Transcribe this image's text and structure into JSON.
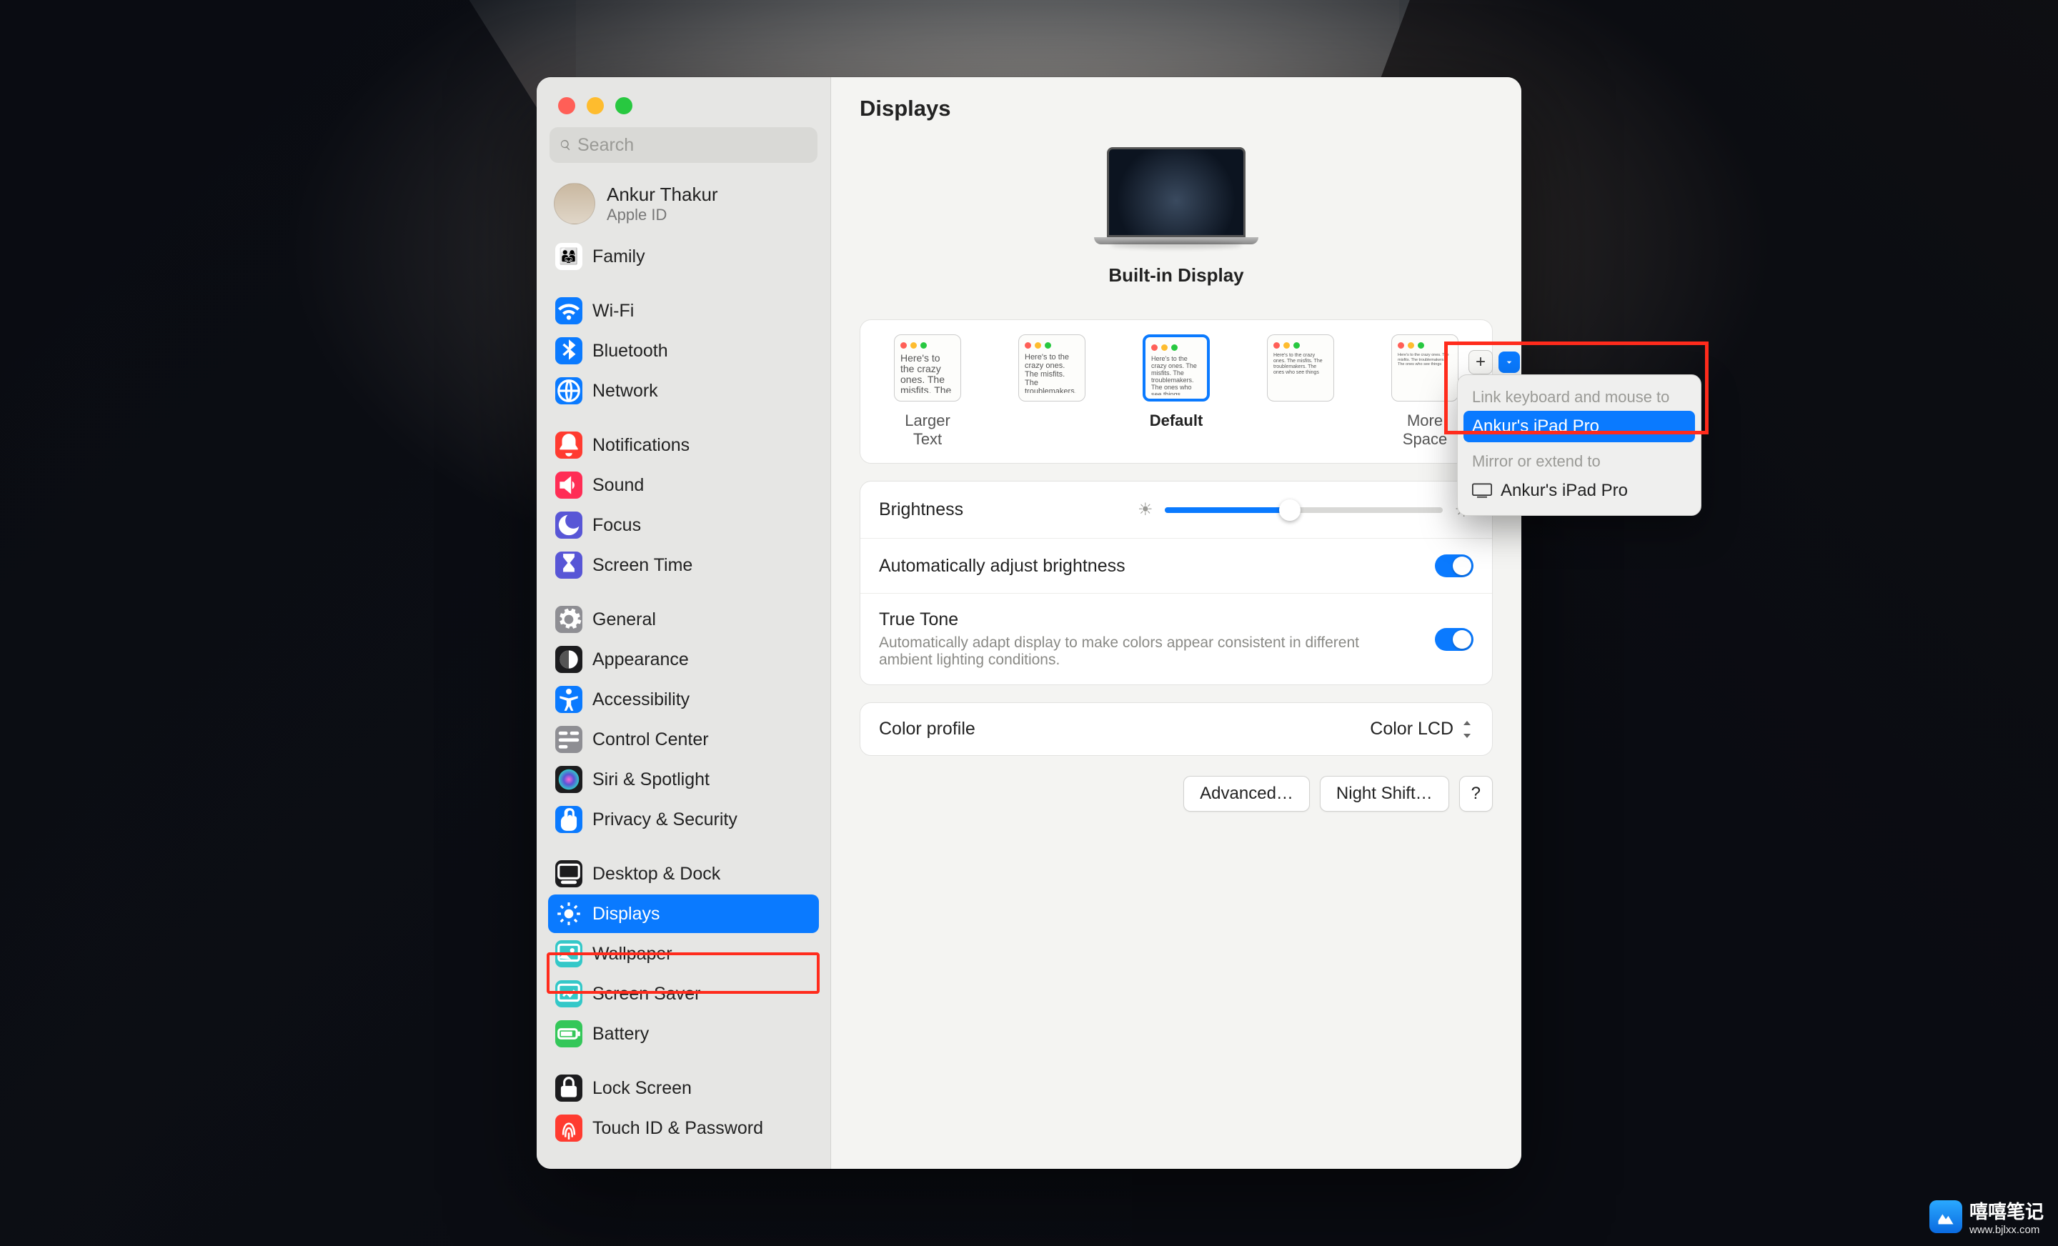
{
  "page_title": "Displays",
  "search": {
    "placeholder": "Search"
  },
  "account": {
    "name": "Ankur Thakur",
    "sub": "Apple ID"
  },
  "sidebar": {
    "groups": [
      [
        {
          "label": "Family",
          "icon": "👨‍👩‍👧",
          "bg": "#ffffff",
          "fg": "#2aa9ff"
        }
      ],
      [
        {
          "label": "Wi-Fi",
          "icon": "wifi",
          "bg": "#0a7aff"
        },
        {
          "label": "Bluetooth",
          "icon": "bt",
          "bg": "#0a7aff"
        },
        {
          "label": "Network",
          "icon": "net",
          "bg": "#0a7aff"
        }
      ],
      [
        {
          "label": "Notifications",
          "icon": "bell",
          "bg": "#ff3b30"
        },
        {
          "label": "Sound",
          "icon": "snd",
          "bg": "#ff2d55"
        },
        {
          "label": "Focus",
          "icon": "moon",
          "bg": "#5856d6"
        },
        {
          "label": "Screen Time",
          "icon": "hour",
          "bg": "#5856d6"
        }
      ],
      [
        {
          "label": "General",
          "icon": "gear",
          "bg": "#8e8e93"
        },
        {
          "label": "Appearance",
          "icon": "appr",
          "bg": "#1c1c1e"
        },
        {
          "label": "Accessibility",
          "icon": "acc",
          "bg": "#0a7aff"
        },
        {
          "label": "Control Center",
          "icon": "cc",
          "bg": "#8e8e93"
        },
        {
          "label": "Siri & Spotlight",
          "icon": "siri",
          "bg": "#1c1c1e"
        },
        {
          "label": "Privacy & Security",
          "icon": "hand",
          "bg": "#0a7aff"
        }
      ],
      [
        {
          "label": "Desktop & Dock",
          "icon": "dock",
          "bg": "#1c1c1e"
        },
        {
          "label": "Displays",
          "icon": "disp",
          "bg": "#0a7aff",
          "selected": true
        },
        {
          "label": "Wallpaper",
          "icon": "wall",
          "bg": "#34c8c8"
        },
        {
          "label": "Screen Saver",
          "icon": "ss",
          "bg": "#34c8c8"
        },
        {
          "label": "Battery",
          "icon": "bat",
          "bg": "#34c759"
        }
      ],
      [
        {
          "label": "Lock Screen",
          "icon": "lock",
          "bg": "#1c1c1e"
        },
        {
          "label": "Touch ID & Password",
          "icon": "finger",
          "bg": "#ff3b30"
        }
      ]
    ]
  },
  "display": {
    "name": "Built-in Display"
  },
  "popup": {
    "section1": "Link keyboard and mouse to",
    "opt1": "Ankur's iPad Pro",
    "section2": "Mirror or extend to",
    "opt2": "Ankur's iPad Pro"
  },
  "resolution": {
    "options": [
      "Larger Text",
      "",
      "Default",
      "",
      "More Space"
    ],
    "preview_text": "Here's to the crazy ones. The misfits. The troublemakers. The ones who see things"
  },
  "settings": {
    "brightness": {
      "label": "Brightness",
      "value": 45
    },
    "auto_brightness": {
      "label": "Automatically adjust brightness",
      "on": true
    },
    "true_tone": {
      "label": "True Tone",
      "sub": "Automatically adapt display to make colors appear consistent in different ambient lighting conditions.",
      "on": true
    },
    "color_profile": {
      "label": "Color profile",
      "value": "Color LCD"
    }
  },
  "footer": {
    "advanced": "Advanced…",
    "night": "Night Shift…",
    "help": "?"
  },
  "watermark": {
    "title": "嘻嘻笔记",
    "sub": "www.bjlxx.com"
  }
}
